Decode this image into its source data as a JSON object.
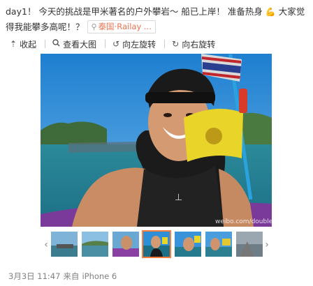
{
  "post": {
    "text_part1": "day1！ 今天的挑战是甲米著名的户外攀岩～ 船已上岸！ 准备热身 ",
    "emoji": "💪",
    "text_part2": " 大家觉得我能攀多高呢！？",
    "location_label": "泰国·Railay ..."
  },
  "toolbar": {
    "collapse_label": "收起",
    "view_large_label": "查看大图",
    "rotate_left_label": "向左旋转",
    "rotate_right_label": "向右旋转"
  },
  "photo": {
    "watermark": "weibo.com/doublel"
  },
  "meta": {
    "date": "3月3日 11:47",
    "source_prefix": "来自",
    "source": "iPhone 6"
  },
  "thumbnails": {
    "count": 7,
    "active_index": 3
  },
  "colors": {
    "accent": "#fa7d3c",
    "location": "#eb7350",
    "meta": "#808080"
  }
}
